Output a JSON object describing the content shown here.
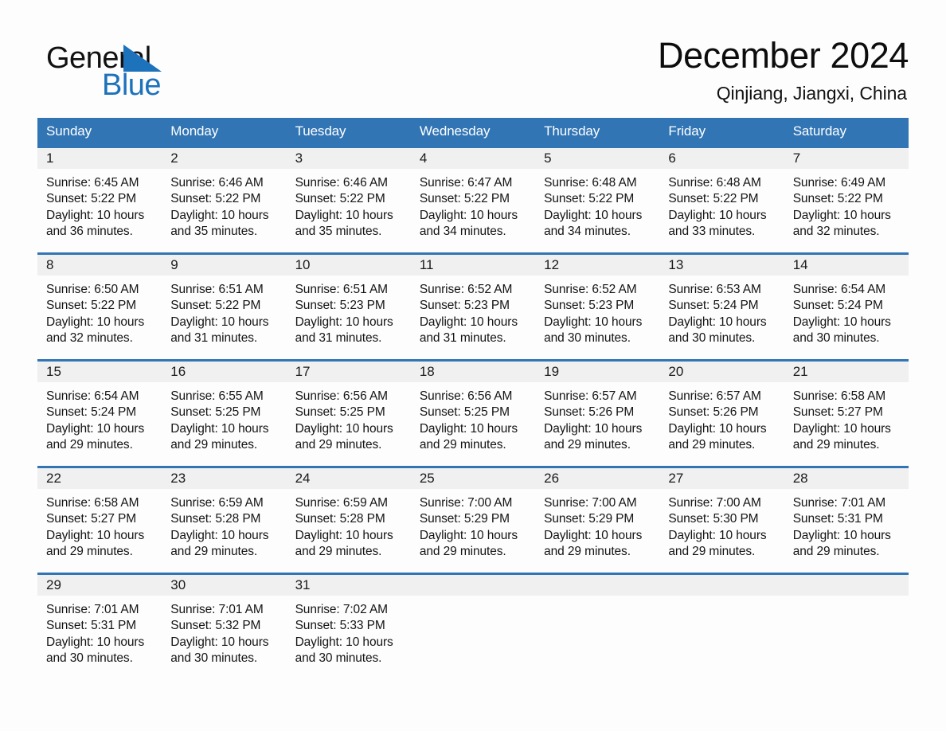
{
  "brand": {
    "name_part1": "General",
    "name_part2": "Blue",
    "triangle_icon": "triangle-logo-icon",
    "accent_color": "#1d72bc"
  },
  "header": {
    "title": "December 2024",
    "location": "Qinjiang, Jiangxi, China"
  },
  "theme": {
    "header_blue": "#3175b4",
    "daynum_gray": "#f0f0f0",
    "page_background": "#fdfdfd"
  },
  "calendar": {
    "weekday_headers": [
      "Sunday",
      "Monday",
      "Tuesday",
      "Wednesday",
      "Thursday",
      "Friday",
      "Saturday"
    ],
    "weeks": [
      [
        {
          "day": "1",
          "sunrise": "Sunrise: 6:45 AM",
          "sunset": "Sunset: 5:22 PM",
          "daylight_line1": "Daylight: 10 hours",
          "daylight_line2": "and 36 minutes."
        },
        {
          "day": "2",
          "sunrise": "Sunrise: 6:46 AM",
          "sunset": "Sunset: 5:22 PM",
          "daylight_line1": "Daylight: 10 hours",
          "daylight_line2": "and 35 minutes."
        },
        {
          "day": "3",
          "sunrise": "Sunrise: 6:46 AM",
          "sunset": "Sunset: 5:22 PM",
          "daylight_line1": "Daylight: 10 hours",
          "daylight_line2": "and 35 minutes."
        },
        {
          "day": "4",
          "sunrise": "Sunrise: 6:47 AM",
          "sunset": "Sunset: 5:22 PM",
          "daylight_line1": "Daylight: 10 hours",
          "daylight_line2": "and 34 minutes."
        },
        {
          "day": "5",
          "sunrise": "Sunrise: 6:48 AM",
          "sunset": "Sunset: 5:22 PM",
          "daylight_line1": "Daylight: 10 hours",
          "daylight_line2": "and 34 minutes."
        },
        {
          "day": "6",
          "sunrise": "Sunrise: 6:48 AM",
          "sunset": "Sunset: 5:22 PM",
          "daylight_line1": "Daylight: 10 hours",
          "daylight_line2": "and 33 minutes."
        },
        {
          "day": "7",
          "sunrise": "Sunrise: 6:49 AM",
          "sunset": "Sunset: 5:22 PM",
          "daylight_line1": "Daylight: 10 hours",
          "daylight_line2": "and 32 minutes."
        }
      ],
      [
        {
          "day": "8",
          "sunrise": "Sunrise: 6:50 AM",
          "sunset": "Sunset: 5:22 PM",
          "daylight_line1": "Daylight: 10 hours",
          "daylight_line2": "and 32 minutes."
        },
        {
          "day": "9",
          "sunrise": "Sunrise: 6:51 AM",
          "sunset": "Sunset: 5:22 PM",
          "daylight_line1": "Daylight: 10 hours",
          "daylight_line2": "and 31 minutes."
        },
        {
          "day": "10",
          "sunrise": "Sunrise: 6:51 AM",
          "sunset": "Sunset: 5:23 PM",
          "daylight_line1": "Daylight: 10 hours",
          "daylight_line2": "and 31 minutes."
        },
        {
          "day": "11",
          "sunrise": "Sunrise: 6:52 AM",
          "sunset": "Sunset: 5:23 PM",
          "daylight_line1": "Daylight: 10 hours",
          "daylight_line2": "and 31 minutes."
        },
        {
          "day": "12",
          "sunrise": "Sunrise: 6:52 AM",
          "sunset": "Sunset: 5:23 PM",
          "daylight_line1": "Daylight: 10 hours",
          "daylight_line2": "and 30 minutes."
        },
        {
          "day": "13",
          "sunrise": "Sunrise: 6:53 AM",
          "sunset": "Sunset: 5:24 PM",
          "daylight_line1": "Daylight: 10 hours",
          "daylight_line2": "and 30 minutes."
        },
        {
          "day": "14",
          "sunrise": "Sunrise: 6:54 AM",
          "sunset": "Sunset: 5:24 PM",
          "daylight_line1": "Daylight: 10 hours",
          "daylight_line2": "and 30 minutes."
        }
      ],
      [
        {
          "day": "15",
          "sunrise": "Sunrise: 6:54 AM",
          "sunset": "Sunset: 5:24 PM",
          "daylight_line1": "Daylight: 10 hours",
          "daylight_line2": "and 29 minutes."
        },
        {
          "day": "16",
          "sunrise": "Sunrise: 6:55 AM",
          "sunset": "Sunset: 5:25 PM",
          "daylight_line1": "Daylight: 10 hours",
          "daylight_line2": "and 29 minutes."
        },
        {
          "day": "17",
          "sunrise": "Sunrise: 6:56 AM",
          "sunset": "Sunset: 5:25 PM",
          "daylight_line1": "Daylight: 10 hours",
          "daylight_line2": "and 29 minutes."
        },
        {
          "day": "18",
          "sunrise": "Sunrise: 6:56 AM",
          "sunset": "Sunset: 5:25 PM",
          "daylight_line1": "Daylight: 10 hours",
          "daylight_line2": "and 29 minutes."
        },
        {
          "day": "19",
          "sunrise": "Sunrise: 6:57 AM",
          "sunset": "Sunset: 5:26 PM",
          "daylight_line1": "Daylight: 10 hours",
          "daylight_line2": "and 29 minutes."
        },
        {
          "day": "20",
          "sunrise": "Sunrise: 6:57 AM",
          "sunset": "Sunset: 5:26 PM",
          "daylight_line1": "Daylight: 10 hours",
          "daylight_line2": "and 29 minutes."
        },
        {
          "day": "21",
          "sunrise": "Sunrise: 6:58 AM",
          "sunset": "Sunset: 5:27 PM",
          "daylight_line1": "Daylight: 10 hours",
          "daylight_line2": "and 29 minutes."
        }
      ],
      [
        {
          "day": "22",
          "sunrise": "Sunrise: 6:58 AM",
          "sunset": "Sunset: 5:27 PM",
          "daylight_line1": "Daylight: 10 hours",
          "daylight_line2": "and 29 minutes."
        },
        {
          "day": "23",
          "sunrise": "Sunrise: 6:59 AM",
          "sunset": "Sunset: 5:28 PM",
          "daylight_line1": "Daylight: 10 hours",
          "daylight_line2": "and 29 minutes."
        },
        {
          "day": "24",
          "sunrise": "Sunrise: 6:59 AM",
          "sunset": "Sunset: 5:28 PM",
          "daylight_line1": "Daylight: 10 hours",
          "daylight_line2": "and 29 minutes."
        },
        {
          "day": "25",
          "sunrise": "Sunrise: 7:00 AM",
          "sunset": "Sunset: 5:29 PM",
          "daylight_line1": "Daylight: 10 hours",
          "daylight_line2": "and 29 minutes."
        },
        {
          "day": "26",
          "sunrise": "Sunrise: 7:00 AM",
          "sunset": "Sunset: 5:29 PM",
          "daylight_line1": "Daylight: 10 hours",
          "daylight_line2": "and 29 minutes."
        },
        {
          "day": "27",
          "sunrise": "Sunrise: 7:00 AM",
          "sunset": "Sunset: 5:30 PM",
          "daylight_line1": "Daylight: 10 hours",
          "daylight_line2": "and 29 minutes."
        },
        {
          "day": "28",
          "sunrise": "Sunrise: 7:01 AM",
          "sunset": "Sunset: 5:31 PM",
          "daylight_line1": "Daylight: 10 hours",
          "daylight_line2": "and 29 minutes."
        }
      ],
      [
        {
          "day": "29",
          "sunrise": "Sunrise: 7:01 AM",
          "sunset": "Sunset: 5:31 PM",
          "daylight_line1": "Daylight: 10 hours",
          "daylight_line2": "and 30 minutes."
        },
        {
          "day": "30",
          "sunrise": "Sunrise: 7:01 AM",
          "sunset": "Sunset: 5:32 PM",
          "daylight_line1": "Daylight: 10 hours",
          "daylight_line2": "and 30 minutes."
        },
        {
          "day": "31",
          "sunrise": "Sunrise: 7:02 AM",
          "sunset": "Sunset: 5:33 PM",
          "daylight_line1": "Daylight: 10 hours",
          "daylight_line2": "and 30 minutes."
        },
        {
          "day": "",
          "sunrise": "",
          "sunset": "",
          "daylight_line1": "",
          "daylight_line2": ""
        },
        {
          "day": "",
          "sunrise": "",
          "sunset": "",
          "daylight_line1": "",
          "daylight_line2": ""
        },
        {
          "day": "",
          "sunrise": "",
          "sunset": "",
          "daylight_line1": "",
          "daylight_line2": ""
        },
        {
          "day": "",
          "sunrise": "",
          "sunset": "",
          "daylight_line1": "",
          "daylight_line2": ""
        }
      ]
    ]
  }
}
